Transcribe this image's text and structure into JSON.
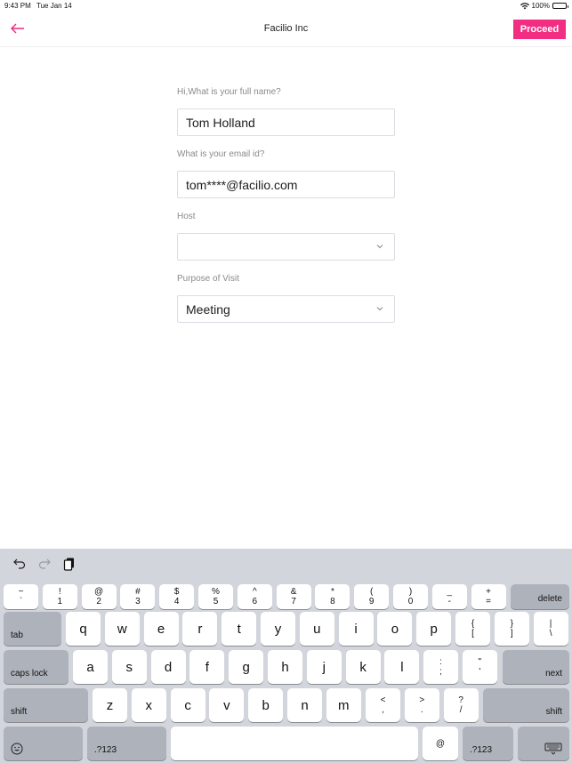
{
  "status_bar": {
    "time": "9:43 PM",
    "date": "Tue Jan 14",
    "battery": "100%"
  },
  "nav": {
    "title": "Facilio Inc",
    "proceed_label": "Proceed",
    "accent_color": "#f22e83"
  },
  "form": {
    "fields": [
      {
        "label": "Hi,What is your full name?",
        "value": "Tom Holland",
        "type": "text"
      },
      {
        "label": "What is your email id?",
        "value": "tom****@facilio.com",
        "type": "text"
      },
      {
        "label": "Host",
        "value": "",
        "type": "select"
      },
      {
        "label": "Purpose of Visit",
        "value": "Meeting",
        "type": "select"
      }
    ]
  },
  "keyboard": {
    "toolbar": [
      "undo-icon",
      "redo-icon",
      "paste-icon"
    ],
    "row1": [
      {
        "top": "~",
        "bottom": "`"
      },
      {
        "top": "!",
        "bottom": "1"
      },
      {
        "top": "@",
        "bottom": "2"
      },
      {
        "top": "#",
        "bottom": "3"
      },
      {
        "top": "$",
        "bottom": "4"
      },
      {
        "top": "%",
        "bottom": "5"
      },
      {
        "top": "^",
        "bottom": "6"
      },
      {
        "top": "&",
        "bottom": "7"
      },
      {
        "top": "*",
        "bottom": "8"
      },
      {
        "top": "(",
        "bottom": "9"
      },
      {
        "top": ")",
        "bottom": "0"
      },
      {
        "top": "_",
        "bottom": "-"
      },
      {
        "top": "+",
        "bottom": "="
      }
    ],
    "delete": "delete",
    "tab": "tab",
    "row2": [
      "q",
      "w",
      "e",
      "r",
      "t",
      "y",
      "u",
      "i",
      "o",
      "p"
    ],
    "row2_dual": [
      {
        "top": "{",
        "bottom": "["
      },
      {
        "top": "}",
        "bottom": "]"
      },
      {
        "top": "|",
        "bottom": "\\"
      }
    ],
    "caps_lock": "caps lock",
    "row3": [
      "a",
      "s",
      "d",
      "f",
      "g",
      "h",
      "j",
      "k",
      "l"
    ],
    "row3_dual": [
      {
        "top": ":",
        "bottom": ";"
      },
      {
        "top": "\"",
        "bottom": "'"
      }
    ],
    "next": "next",
    "shift": "shift",
    "row4": [
      "z",
      "x",
      "c",
      "v",
      "b",
      "n",
      "m"
    ],
    "row4_dual": [
      {
        "top": "<",
        "bottom": ","
      },
      {
        "top": ">",
        "bottom": "."
      },
      {
        "top": "?",
        "bottom": "/"
      }
    ],
    "numbers_label": ".?123",
    "at": "@"
  }
}
